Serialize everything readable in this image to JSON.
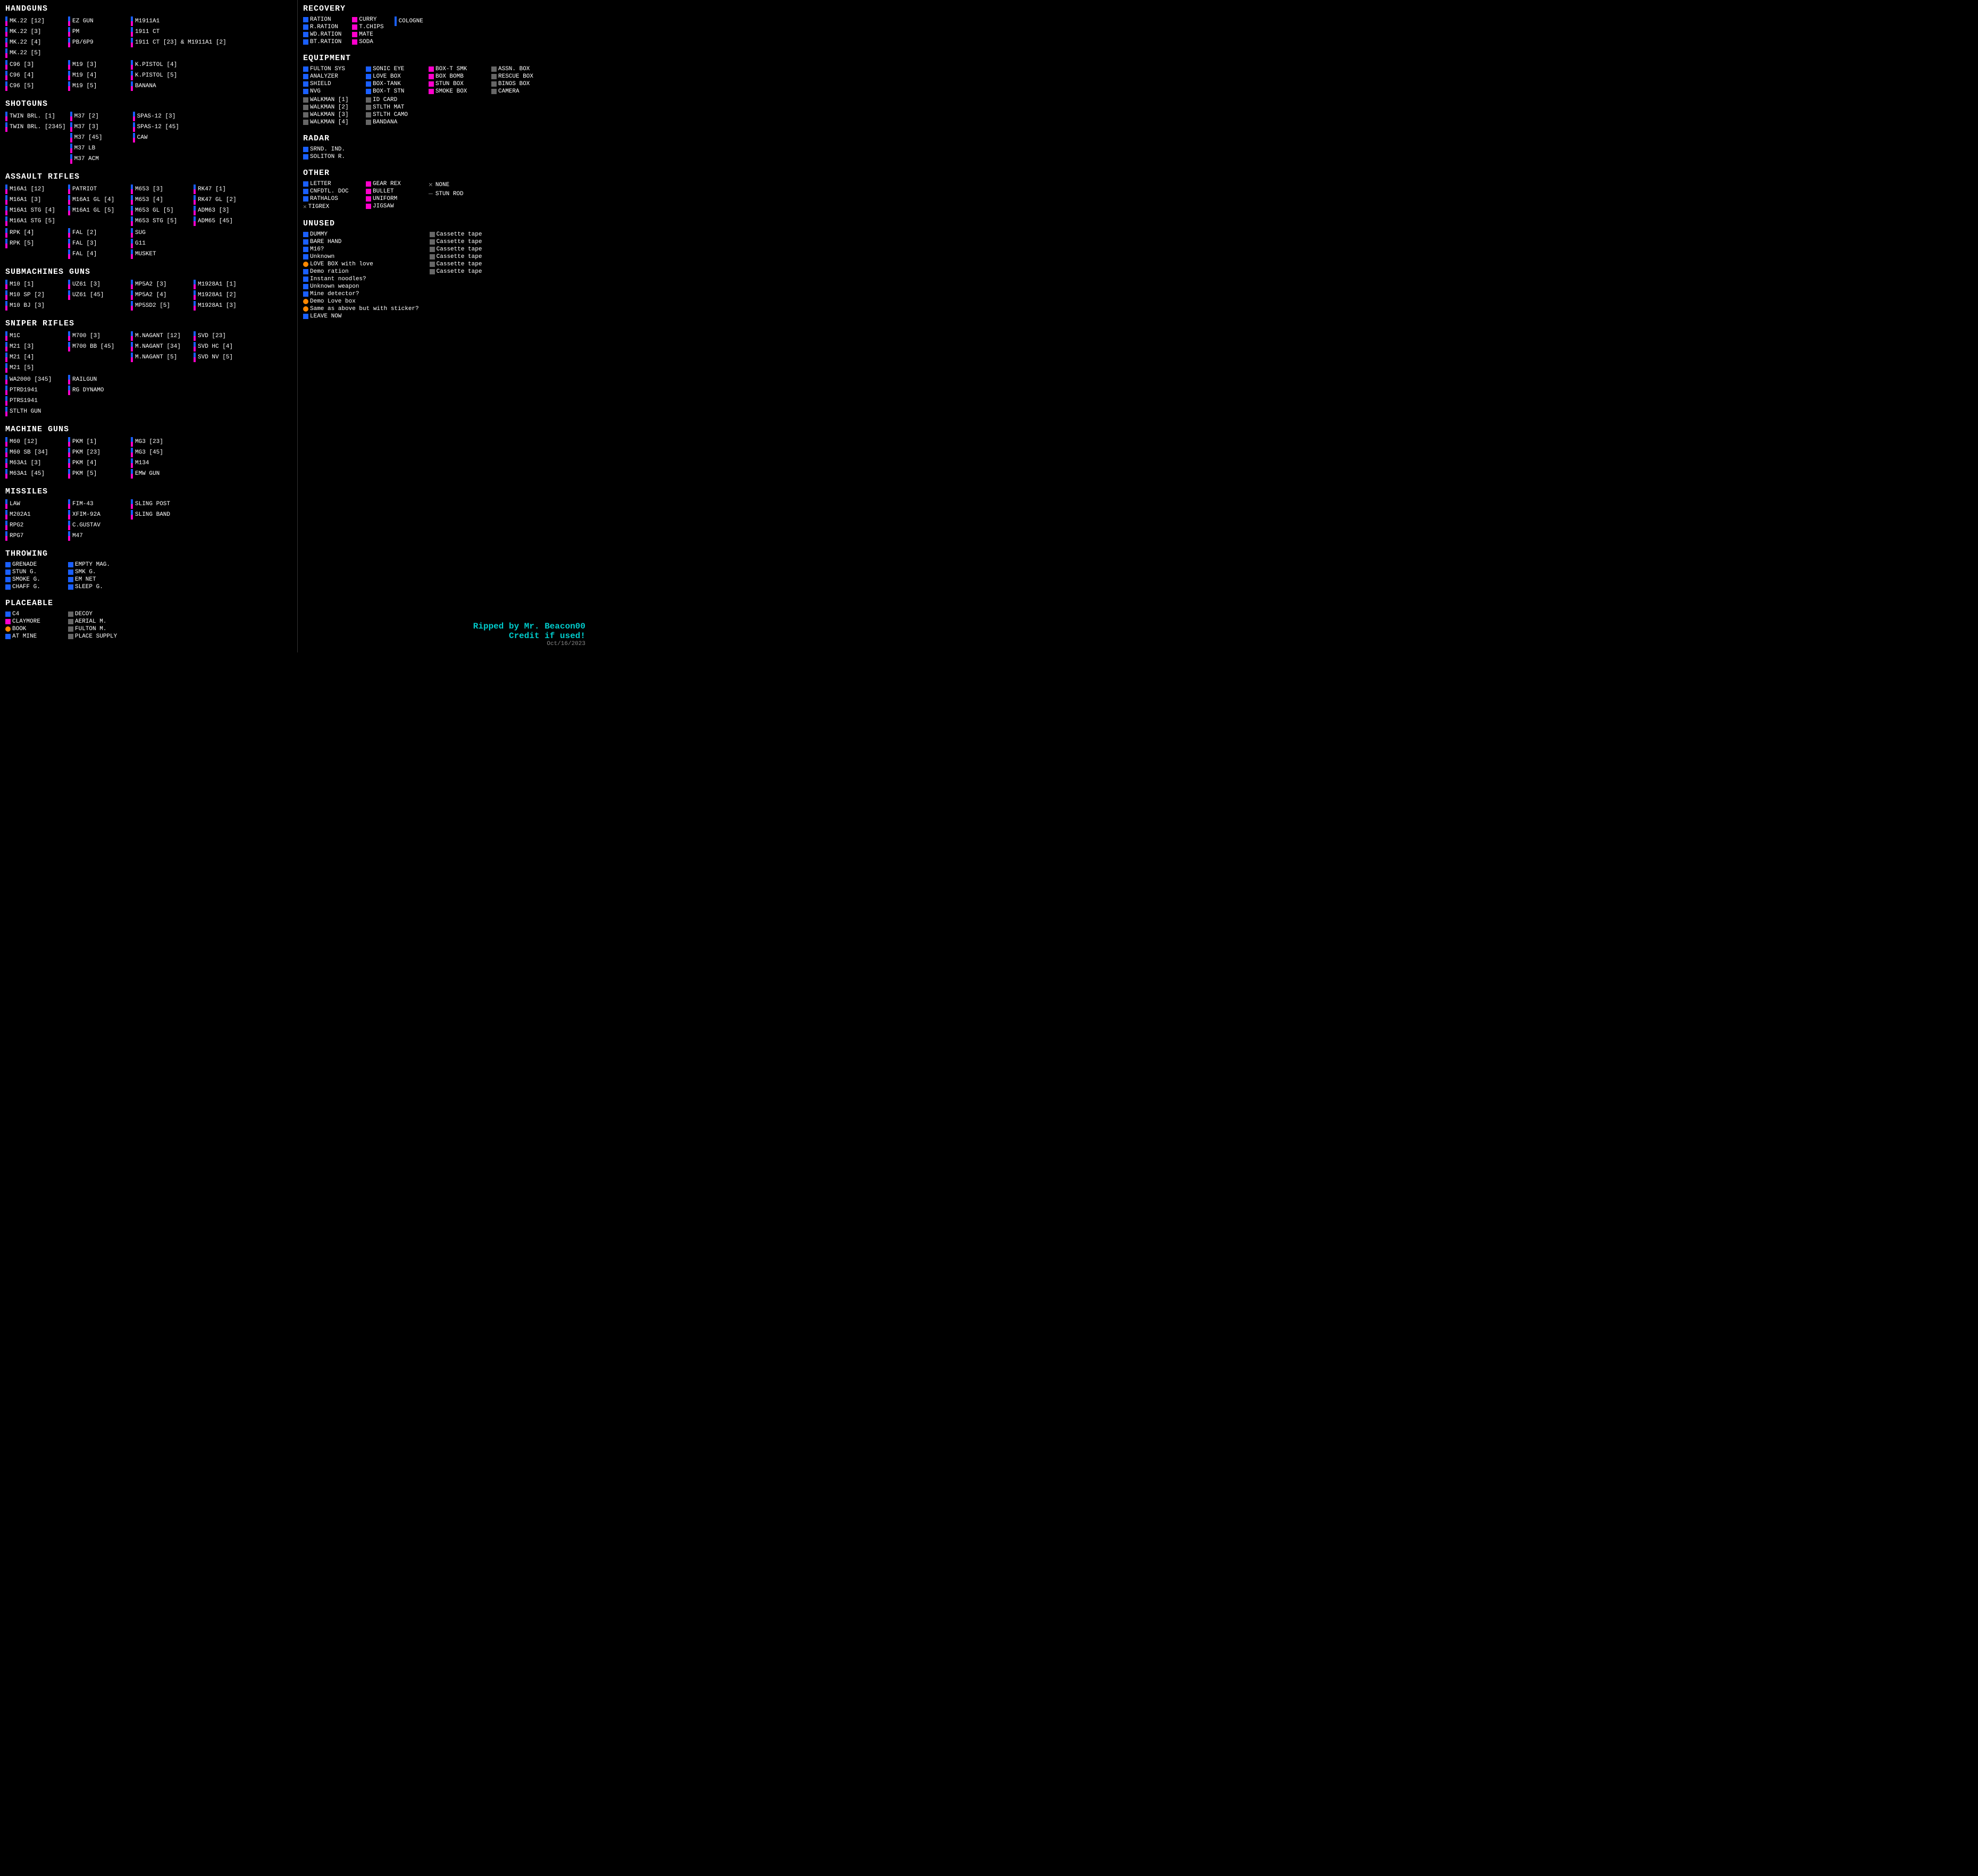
{
  "sections": {
    "handguns": {
      "title": "HANDGUNS",
      "cols": [
        [
          "MK.22 [12]",
          "MK.22 [3]",
          "MK.22 [4]",
          "MK.22 [5]"
        ],
        [
          "EZ GUN",
          "PM",
          "PB/6P9"
        ],
        [
          "M1911A1",
          "1911 CT",
          "1911 CT [23] & M1911A1 [2]"
        ],
        [
          "C96 [3]",
          "C96 [4]",
          "C96 [5]"
        ],
        [
          "M19 [3]",
          "M19 [4]",
          "M19 [5]"
        ],
        [
          "K.PISTOL [4]",
          "K.PISTOL [5]",
          "BANANA"
        ]
      ]
    },
    "shotguns": {
      "title": "SHOTGUNS",
      "cols": [
        [
          "TWIN BRL. [1]",
          "TWIN BRL. [2345]"
        ],
        [
          "M37 [2]",
          "M37 [3]",
          "M37 [45]",
          "M37 LB",
          "M37 ACM"
        ],
        [
          "SPAS-12 [3]",
          "SPAS-12 [45]",
          "CAW"
        ]
      ]
    },
    "assault_rifles": {
      "title": "ASSAULT RIFLES",
      "cols": [
        [
          "M16A1 [12]",
          "M16A1 [3]",
          "M16A1 STG [4]",
          "M16A1 STG [5]"
        ],
        [
          "PATRIOT",
          "M16A1 GL [4]",
          "M16A1 GL [5]"
        ],
        [
          "M653 [3]",
          "M653 [4]",
          "M653 GL [5]",
          "M653 STG [5]"
        ],
        [
          "RK47 [1]",
          "RK47 GL [2]",
          "ADM63 [3]",
          "ADM65 [45]"
        ],
        [
          "RPK [4]",
          "RPK [5]"
        ],
        [
          "FAL [2]",
          "FAL [3]",
          "FAL [4]"
        ],
        [
          "SUG",
          "G11",
          "MUSKET"
        ]
      ]
    },
    "smg": {
      "title": "SUBMACHINES GUNS",
      "cols": [
        [
          "M10 [1]",
          "M10 SP [2]",
          "M10 BJ [3]"
        ],
        [
          "UZ61 [3]",
          "UZ61 [45]"
        ],
        [
          "MP5A2 [3]",
          "MP5A2 [4]",
          "MP5SD2 [5]"
        ],
        [
          "M1928A1 [1]",
          "M1928A1 [2]",
          "M1928A1 [3]"
        ]
      ]
    },
    "sniper": {
      "title": "SNIPER RIFLES",
      "cols": [
        [
          "M1C",
          "M21 [3]",
          "M21 [4]",
          "M21 [5]"
        ],
        [
          "M700 [3]",
          "M700 BB [45]"
        ],
        [
          "M.NAGANT [12]",
          "M.NAGANT [34]",
          "M.NAGANT [5]"
        ],
        [
          "SVD [23]",
          "SVD HC [4]",
          "SVD NV [5]"
        ],
        [
          "WA2000 [345]",
          "PTRD1941",
          "PTRS1941",
          "STLTH GUN"
        ],
        [
          "RAILGUN",
          "RG DYNAMO"
        ]
      ]
    },
    "machine_guns": {
      "title": "MACHINE GUNS",
      "cols": [
        [
          "M60 [12]",
          "M60 SB [34]",
          "M63A1 [3]",
          "M63A1 [45]"
        ],
        [
          "PKM [1]",
          "PKM [23]",
          "PKM [4]",
          "PKM [5]"
        ],
        [
          "MG3 [23]",
          "MG3 [45]",
          "M134",
          "EMW GUN"
        ]
      ]
    },
    "missiles": {
      "title": "MISSILES",
      "cols": [
        [
          "LAW",
          "M202A1",
          "RPG2",
          "RPG7"
        ],
        [
          "FIM-43",
          "XFIM-92A",
          "C.GUSTAV",
          "M47"
        ],
        [
          "SLING POST",
          "SLING BAND"
        ]
      ]
    },
    "throwing": {
      "title": "THROWING",
      "cols": [
        [
          "GRENADE",
          "STUN G.",
          "SMOKE G.",
          "CHAFF G."
        ],
        [
          "EMPTY MAG.",
          "SMK G.",
          "EM NET",
          "SLEEP G."
        ]
      ]
    },
    "placeable": {
      "title": "PLACEABLE",
      "cols": [
        [
          "C4",
          "CLAYMORE",
          "BOOK",
          "AT MINE"
        ],
        [
          "DECOY",
          "AERIAL M.",
          "FULTON M.",
          "PLACE SUPPLY"
        ]
      ]
    },
    "recovery": {
      "title": "RECOVERY",
      "cols": [
        [
          "RATION",
          "R.RATION",
          "WD.RATION",
          "BT.RATION"
        ],
        [
          "CURRY",
          "T.CHIPS",
          "MATE",
          "SODA"
        ],
        [
          "COLOGNE"
        ]
      ]
    },
    "equipment": {
      "title": "EQUIPMENT",
      "cols": [
        [
          "FULTON SYS",
          "ANALYZER",
          "SHIELD",
          "NVG"
        ],
        [
          "SONIC EYE",
          "LOVE BOX",
          "BOX-TANK",
          "BOX-T STN"
        ],
        [
          "BOX-T SMK",
          "BOX BOMB",
          "STUN BOX",
          "SMOKE BOX"
        ],
        [
          "ASSN. BOX",
          "RESCUE BOX",
          "BINOS BOX",
          "CAMERA"
        ],
        [
          "WALKMAN [1]",
          "WALKMAN [2]",
          "WALKMAN [3]",
          "WALKMAN [4]"
        ],
        [
          "ID CARD",
          "STLTH MAT",
          "STLTH CAMO",
          "BANDANA"
        ]
      ]
    },
    "radar": {
      "title": "RADAR",
      "items": [
        "SRND. IND.",
        "SOLITON R."
      ]
    },
    "other": {
      "title": "OTHER",
      "cols": [
        [
          "LETTER",
          "CNFDTL. DOC",
          "RATHALOS",
          "TIGREX"
        ],
        [
          "GEAR REX",
          "BULLET",
          "UNIFORM",
          "JIGSAW"
        ],
        [
          "NONE",
          "STUN ROD"
        ]
      ]
    },
    "unused": {
      "title": "UNUSED",
      "left": [
        "DUMMY",
        "BARE HAND",
        "M16?",
        "Unknown",
        "LOVE BOX with love",
        "Demo ration",
        "Instant noodles?",
        "Unknown weapon",
        "Mine detector?",
        "Demo Love box",
        "Same as above but with sticker?",
        "LEAVE NOW"
      ],
      "right": [
        "Cassette tape",
        "Cassette tape",
        "Cassette tape",
        "Cassette tape",
        "Cassette tape",
        "Cassette tape"
      ]
    }
  },
  "footer": {
    "credit": "Ripped by Mr. Beacon00",
    "credit2": "Credit if used!",
    "date": "Oct/16/2023"
  }
}
